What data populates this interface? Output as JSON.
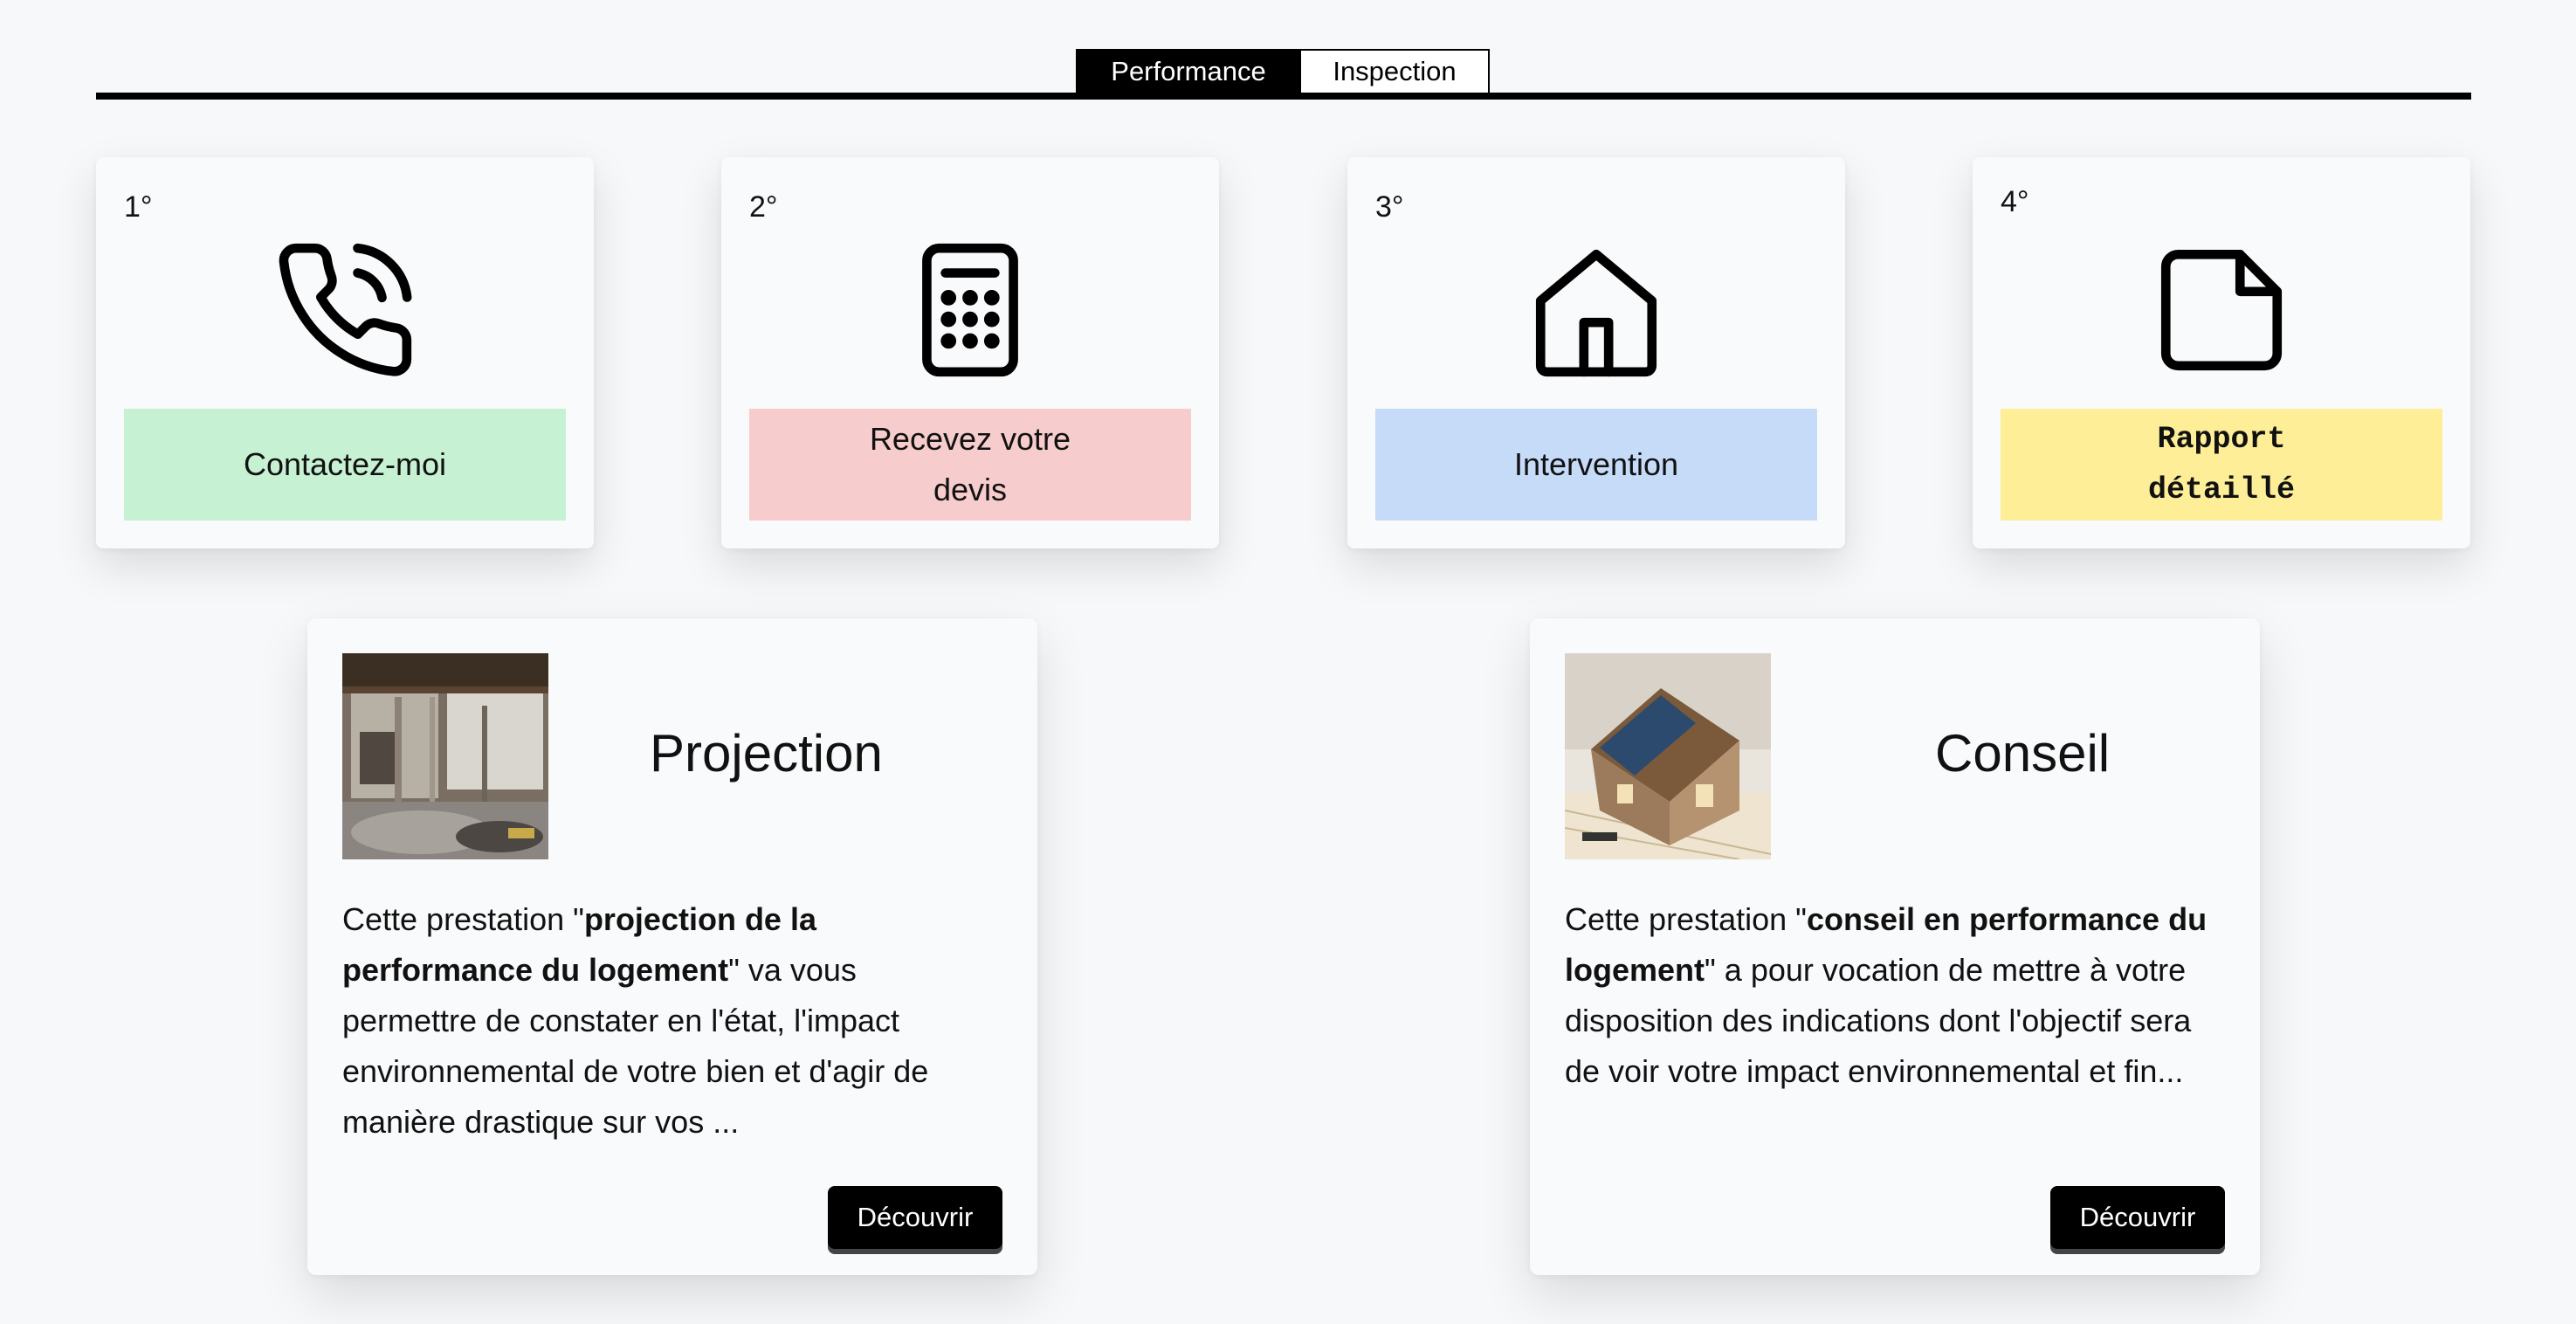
{
  "tabs": [
    {
      "label": "Performance",
      "active": true
    },
    {
      "label": "Inspection",
      "active": false
    }
  ],
  "steps": [
    {
      "number": "1°",
      "label": "Contactez-moi",
      "icon": "phone-icon",
      "color": "#c6f1d3"
    },
    {
      "number": "2°",
      "label": "Recevez votre devis",
      "icon": "calculator-icon",
      "color": "#f6cccc"
    },
    {
      "number": "3°",
      "label": "Intervention",
      "icon": "home-icon",
      "color": "#c5dbf8"
    },
    {
      "number": "4°",
      "label": "Rapport détaillé",
      "icon": "document-icon",
      "color": "#fdee97"
    }
  ],
  "services": [
    {
      "title": "Projection",
      "text_before": "Cette prestation \"",
      "text_bold": "projection de la performance du logement",
      "text_after": "\" va vous permettre de constater en l'état, l'impact environnemental de votre bien et d'agir de manière drastique sur vos ...",
      "button": "Découvrir",
      "image": "construction-interior-photo"
    },
    {
      "title": "Conseil",
      "text_before": "Cette prestation \"",
      "text_bold": "conseil en performance du logement",
      "text_after": "\" a pour vocation de mettre à votre disposition des indications dont l'objectif sera de voir votre impact environnemental et fin...",
      "button": "Découvrir",
      "image": "house-solar-model-photo"
    }
  ]
}
